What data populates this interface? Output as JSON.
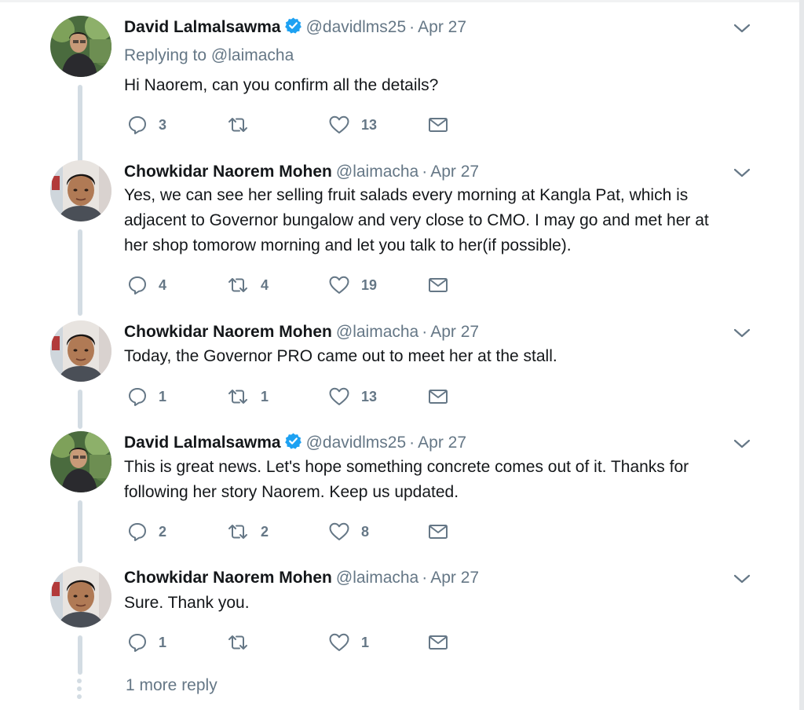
{
  "colors": {
    "text": "#14171a",
    "secondary": "#657786",
    "verified": "#1da1f2",
    "thread_line": "#d3dce3"
  },
  "tweets": [
    {
      "name": "David Lalmalsawma",
      "verified": true,
      "handle": "@davidlms25",
      "dot": "·",
      "date": "Apr 27",
      "replying_prefix": "Replying to",
      "replying_to": "@laimacha",
      "text": "Hi Naorem, can you confirm all the details?",
      "replies": "3",
      "retweets": "",
      "likes": "13",
      "avatar": "avatar-david"
    },
    {
      "name": "Chowkidar Naorem Mohen",
      "verified": false,
      "handle": "@laimacha",
      "dot": "·",
      "date": "Apr 27",
      "text_lines": [
        "Yes, we can see her selling fruit salads every morning at Kangla Pat, which is",
        "adjacent to Governor bungalow and very close to CMO. I may go and met her at",
        "her shop tomorow morning and let you talk to her(if possible)."
      ],
      "replies": "4",
      "retweets": "4",
      "likes": "19",
      "avatar": "avatar-naorem"
    },
    {
      "name": "Chowkidar Naorem Mohen",
      "verified": false,
      "handle": "@laimacha",
      "dot": "·",
      "date": "Apr 27",
      "text": "Today, the Governor PRO came out to meet her at the stall.",
      "replies": "1",
      "retweets": "1",
      "likes": "13",
      "avatar": "avatar-naorem"
    },
    {
      "name": "David Lalmalsawma",
      "verified": true,
      "handle": "@davidlms25",
      "dot": "·",
      "date": "Apr 27",
      "text_lines": [
        "This is great news. Let's hope something concrete comes out of it. Thanks for",
        "following her story Naorem. Keep us updated."
      ],
      "replies": "2",
      "retweets": "2",
      "likes": "8",
      "avatar": "avatar-david"
    },
    {
      "name": "Chowkidar Naorem Mohen",
      "verified": false,
      "handle": "@laimacha",
      "dot": "·",
      "date": "Apr 27",
      "text": "Sure. Thank you.",
      "replies": "1",
      "retweets": "",
      "likes": "1",
      "avatar": "avatar-naorem"
    }
  ],
  "more_replies": "1 more reply",
  "icons": {
    "reply": "reply-icon",
    "retweet": "retweet-icon",
    "like": "heart-icon",
    "dm": "envelope-icon",
    "caret": "chevron-down-icon",
    "verified": "verified-badge-icon"
  }
}
